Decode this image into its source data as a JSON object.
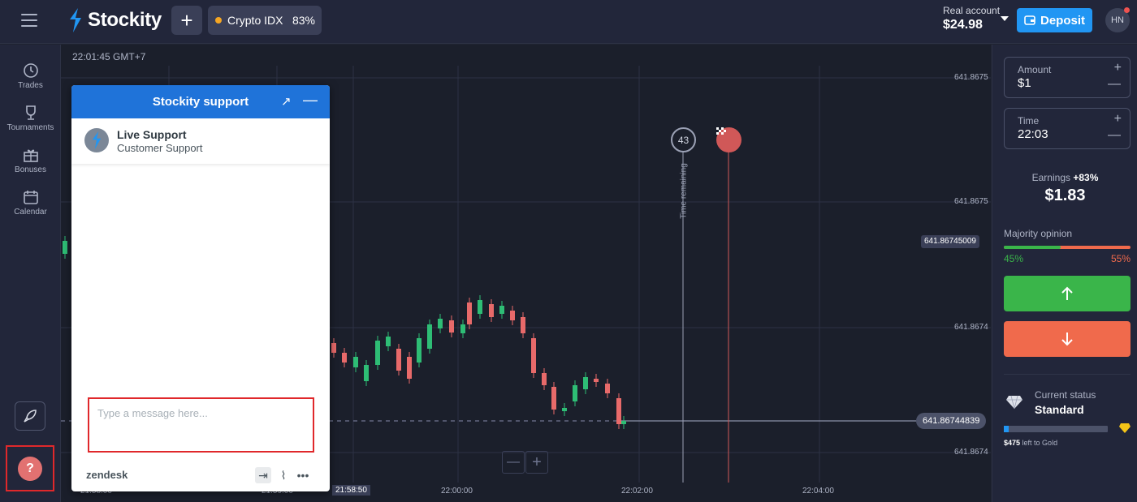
{
  "topbar": {
    "brand": "Stockity",
    "add_label": "+",
    "asset": {
      "name": "Crypto IDX",
      "payout": "83%"
    },
    "account": {
      "label": "Real account",
      "balance": "$24.98"
    },
    "deposit_label": "Deposit",
    "user_initials": "HN"
  },
  "sidebar": {
    "items": [
      {
        "label": "Trades",
        "icon": "clock-icon"
      },
      {
        "label": "Tournaments",
        "icon": "trophy-icon"
      },
      {
        "label": "Bonuses",
        "icon": "gift-icon"
      },
      {
        "label": "Calendar",
        "icon": "calendar-icon"
      }
    ]
  },
  "chart": {
    "time_header": "22:01:45 GMT+7",
    "current_price": "641.86744839",
    "secondary_price": "641.86745009",
    "timer_value": "43",
    "time_remaining_label": "Time remaining",
    "zoom_out": "—",
    "zoom_in": "+",
    "y_ticks": [
      "641.8675",
      "641.8675",
      "641.8674",
      "641.8674"
    ],
    "x_ticks": [
      "21:58:00",
      "21:59:00",
      "21:58:50",
      "22:00:00",
      "22:02:00",
      "22:04:00"
    ]
  },
  "panel": {
    "amount": {
      "label": "Amount",
      "value": "$1"
    },
    "time": {
      "label": "Time",
      "value": "22:03"
    },
    "earnings_label": "Earnings",
    "earnings_pct": "+83%",
    "earnings_value": "$1.83",
    "majority_label": "Majority opinion",
    "majority_up": "45%",
    "majority_down": "55%",
    "majority_up_fraction": 0.45,
    "status_label": "Current status",
    "status_value": "Standard",
    "gold_remaining": "$475",
    "gold_text": "left to Gold",
    "progress_fraction": 0.05
  },
  "support": {
    "title": "Stockity support",
    "agent_name": "Live Support",
    "agent_role": "Customer Support",
    "message_placeholder": "Type a message here...",
    "footer_brand": "zendesk"
  },
  "colors": {
    "brand_blue": "#2196f3",
    "up_green": "#3ab54a",
    "down_red": "#f06a4c",
    "highlight_red": "#e0282b"
  }
}
